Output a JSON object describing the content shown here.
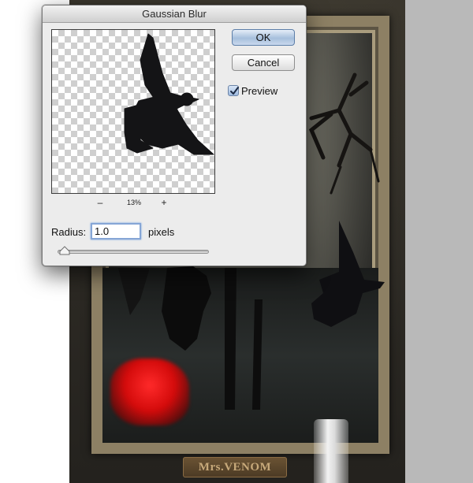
{
  "dialog": {
    "title": "Gaussian Blur",
    "ok_label": "OK",
    "cancel_label": "Cancel",
    "preview_label": "Preview",
    "preview_checked": true,
    "zoom_out_label": "–",
    "zoom_level": "13%",
    "zoom_in_label": "+",
    "radius_label": "Radius:",
    "radius_value": "1.0",
    "radius_unit": "pixels"
  },
  "artwork": {
    "nameplate_text": "Mrs.VENOM",
    "accent_red": "#e01010"
  },
  "icons": {
    "check": "checkmark-icon",
    "slider": "slider-thumb-icon",
    "bird": "crow-icon"
  }
}
